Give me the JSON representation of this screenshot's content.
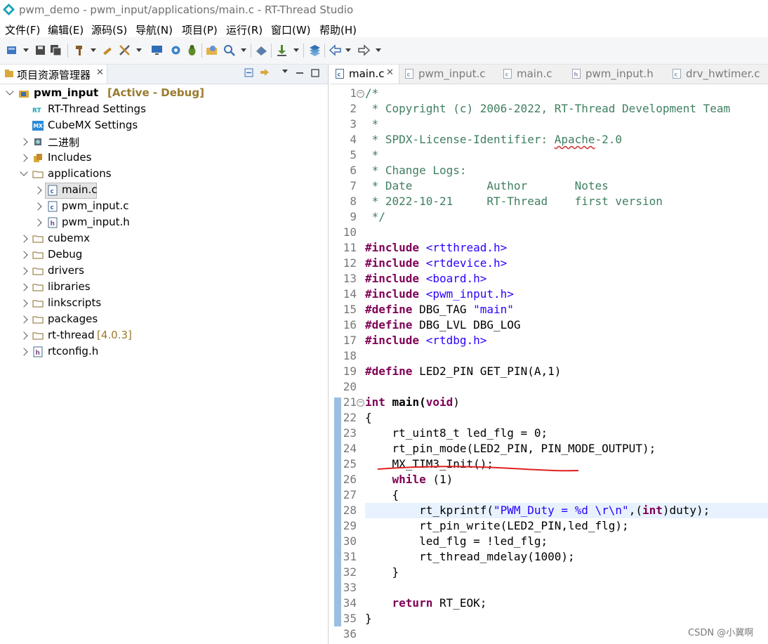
{
  "window": {
    "title": "pwm_demo - pwm_input/applications/main.c - RT-Thread Studio"
  },
  "menu": [
    "文件(F)",
    "编辑(E)",
    "源码(S)",
    "导航(N)",
    "项目(P)",
    "运行(R)",
    "窗口(W)",
    "帮助(H)"
  ],
  "project_explorer": {
    "tab_label": "项目资源管理器",
    "items": [
      {
        "label": "pwm_input",
        "extra": "[Active - Debug]"
      },
      {
        "label": "RT-Thread Settings"
      },
      {
        "label": "CubeMX Settings"
      },
      {
        "label": "二进制"
      },
      {
        "label": "Includes"
      },
      {
        "label": "applications"
      },
      {
        "label": "main.c"
      },
      {
        "label": "pwm_input.c"
      },
      {
        "label": "pwm_input.h"
      },
      {
        "label": "cubemx"
      },
      {
        "label": "Debug"
      },
      {
        "label": "drivers"
      },
      {
        "label": "libraries"
      },
      {
        "label": "linkscripts"
      },
      {
        "label": "packages"
      },
      {
        "label": "rt-thread",
        "extra": "[4.0.3]"
      },
      {
        "label": "rtconfig.h"
      }
    ]
  },
  "editor": {
    "tabs": [
      "main.c",
      "pwm_input.c",
      "main.c",
      "pwm_input.h",
      "drv_hwtimer.c"
    ],
    "line_numbers": [
      "1",
      "2",
      "3",
      "4",
      "5",
      "6",
      "7",
      "8",
      "9",
      "10",
      "11",
      "12",
      "13",
      "14",
      "15",
      "16",
      "17",
      "18",
      "19",
      "20",
      "21",
      "22",
      "23",
      "24",
      "25",
      "26",
      "27",
      "28",
      "29",
      "30",
      "31",
      "32",
      "33",
      "34",
      "35",
      "36"
    ],
    "code": {
      "l1": "/*",
      "l2": " * Copyright (c) 2006-2022, RT-Thread Development Team",
      "l3": " *",
      "l4a": " * SPDX-License-Identifier: ",
      "l4b": "Apache",
      "l4c": "-2.0",
      "l5": " *",
      "l6": " * Change Logs:",
      "l7": " * Date           Author       Notes",
      "l8": " * 2022-10-21     RT-Thread    first version",
      "l9": " */",
      "inc": "#include",
      "def": "#define",
      "l11": " <rtthread.h>",
      "l12": " <rtdevice.h>",
      "l13": " <board.h>",
      "l14": " <pwm_input.h>",
      "l15a": " DBG_TAG ",
      "l15b": "\"main\"",
      "l16": " DBG_LVL DBG_LOG",
      "l17": " <rtdbg.h>",
      "l19": " LED2_PIN GET_PIN(A,1)",
      "l21a": "int",
      "l21b": " main(",
      "l21c": "void",
      "l21d": ")",
      "l22": "{",
      "l23": "    rt_uint8_t led_flg = 0;",
      "l24": "    rt_pin_mode(LED2_PIN, PIN_MODE_OUTPUT);",
      "l25": "    MX_TIM3_Init();",
      "l26a": "    ",
      "l26b": "while",
      "l26c": " (1)",
      "l27": "    {",
      "l28a": "        rt_kprintf(",
      "l28b": "\"PWM_Duty = %d \\r\\n\"",
      "l28c": ",(",
      "l28d": "int",
      "l28e": ")duty);",
      "l29": "        rt_pin_write(LED2_PIN,led_flg);",
      "l30": "        led_flg = !led_flg;",
      "l31": "        rt_thread_mdelay(1000);",
      "l32": "    }",
      "l34a": "    ",
      "l34b": "return",
      "l34c": " RT_EOK;",
      "l35": "}"
    }
  },
  "watermark": "CSDN @小冀啊"
}
